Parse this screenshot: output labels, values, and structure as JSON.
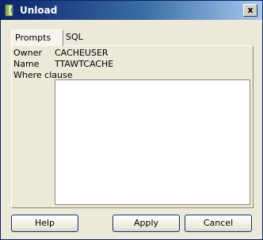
{
  "window": {
    "title": "Unload",
    "close_glyph": "x"
  },
  "tabs": [
    {
      "label": "Prompts",
      "active": true
    },
    {
      "label": "SQL",
      "active": false
    }
  ],
  "fields": {
    "owner_label": "Owner",
    "owner_value": "CACHEUSER",
    "name_label": "Name",
    "name_value": "TTAWTCACHE",
    "where_label": "Where clause",
    "where_value": ""
  },
  "buttons": {
    "help": "Help",
    "apply": "Apply",
    "cancel": "Cancel"
  }
}
